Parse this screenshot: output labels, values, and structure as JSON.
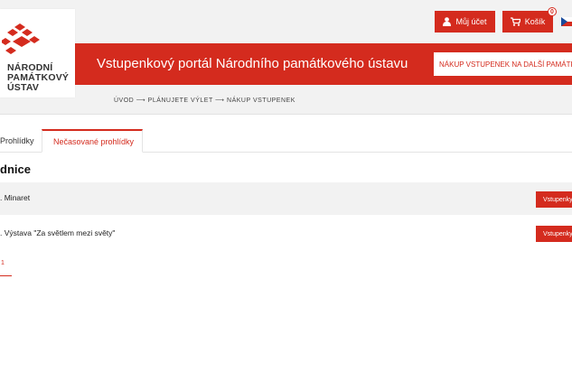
{
  "brand": {
    "logo_lines": [
      "NÁRODNÍ",
      "PAMÁTKOVÝ",
      "ÚSTAV"
    ],
    "logo_icon": "npu-logo-icon",
    "accent_color": "#d42b1e"
  },
  "header": {
    "account_label": "Můj účet",
    "account_icon": "user-icon",
    "cart_label": "Košík",
    "cart_icon": "cart-icon",
    "cart_count": "0",
    "language_flag": "czech-flag-icon"
  },
  "banner": {
    "title": "Vstupenkový portál Národního památkového ústavu",
    "cta_label": "NÁKUP VSTUPENEK NA DALŠÍ PAMÁTKY"
  },
  "breadcrumb": {
    "text": "ÚVOD ⟶ PLÁNUJETE VÝLET ⟶ NÁKUP VSTUPENEK"
  },
  "tabs": [
    {
      "label": "Prohlídky",
      "active": false
    },
    {
      "label": "Nečasované prohlídky",
      "active": true
    }
  ],
  "section": {
    "heading": "dnice"
  },
  "items": [
    {
      "label": ". Minaret",
      "button": "Vstupenky"
    },
    {
      "label": ". Výstava \"Za světlem mezi světy\"",
      "button": "Vstupenky"
    }
  ],
  "pagination": {
    "current_page": "1"
  }
}
